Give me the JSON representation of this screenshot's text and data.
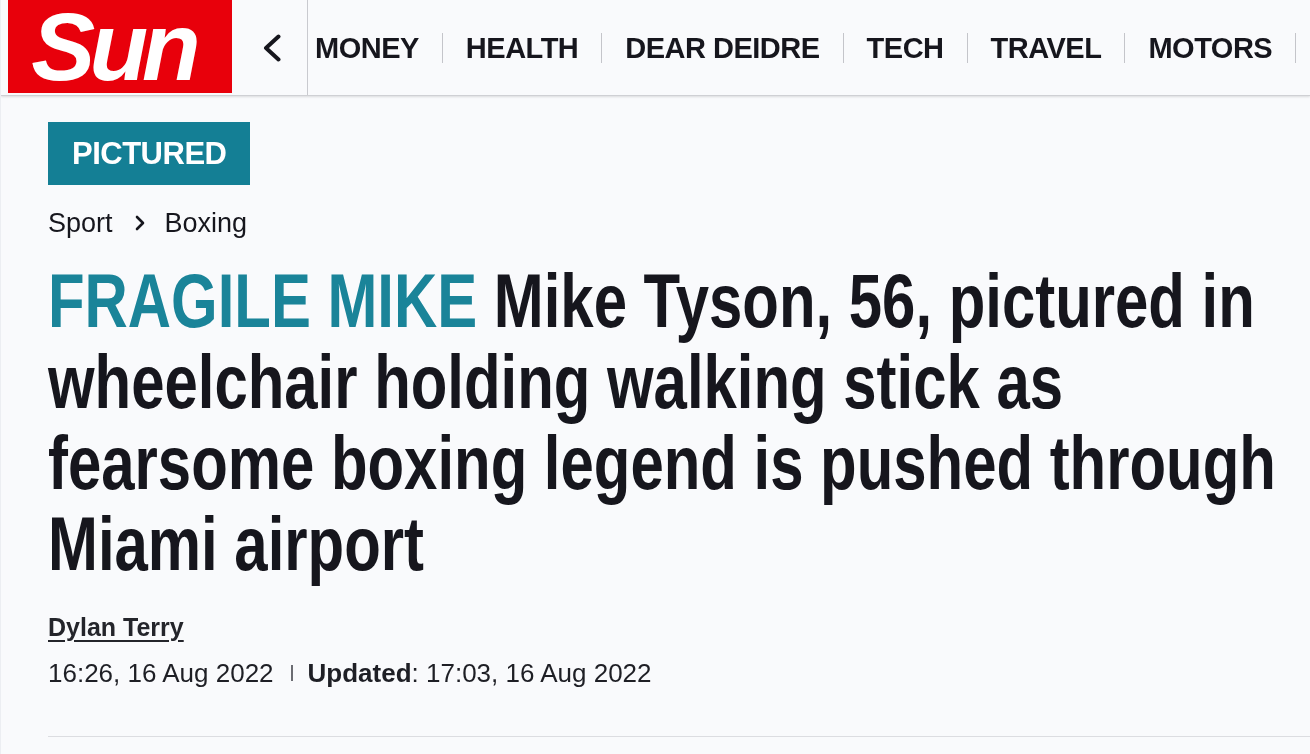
{
  "header": {
    "logo": "Sun",
    "nav": [
      {
        "label": "MONEY"
      },
      {
        "label": "HEALTH"
      },
      {
        "label": "DEAR DEIDRE"
      },
      {
        "label": "TECH"
      },
      {
        "label": "TRAVEL"
      },
      {
        "label": "MOTORS"
      }
    ]
  },
  "article": {
    "tag": "PICTURED",
    "breadcrumb": [
      "Sport",
      "Boxing"
    ],
    "kicker": "FRAGILE MIKE",
    "headline": "Mike Tyson, 56, pictured in wheelchair holding walking stick as fearsome boxing legend is pushed through Miami airport",
    "author": "Dylan Terry",
    "published": "16:26, 16 Aug 2022",
    "updated": "**Updated**: 17:03, 16 Aug 2022"
  }
}
